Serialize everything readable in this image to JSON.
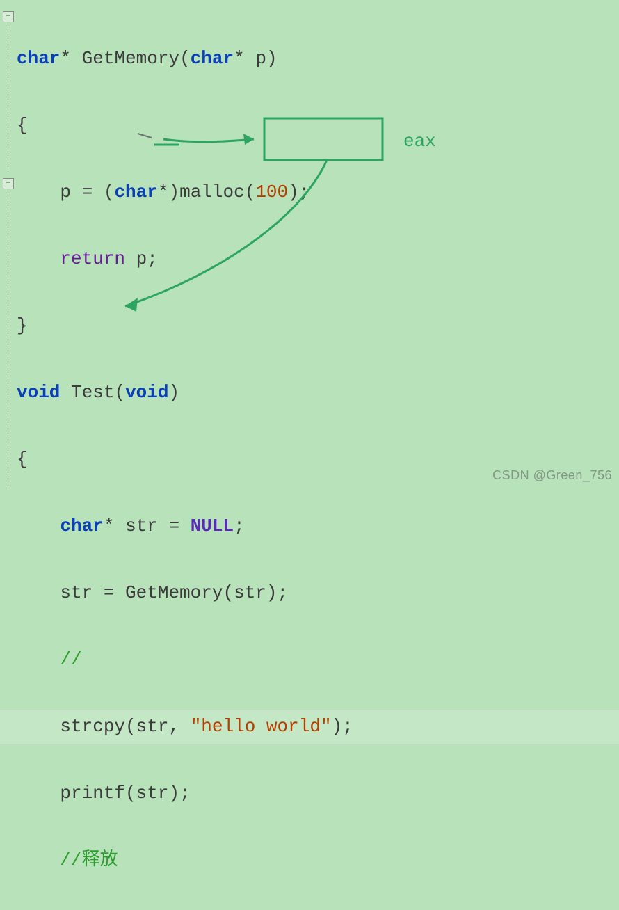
{
  "code": {
    "l1": {
      "kw1": "char",
      "star1": "*",
      "fn": "GetMemory",
      "lp": "(",
      "kw2": "char",
      "star2": "*",
      "p": "p",
      "rp": ")"
    },
    "l2": {
      "brace": "{"
    },
    "l3": {
      "p": "p",
      "eq": " = ",
      "lp": "(",
      "kw": "char",
      "star": "*",
      "rp": ")",
      "fn": "malloc",
      "lp2": "(",
      "num": "100",
      "rp2": ");"
    },
    "l4": {
      "ret": "return",
      "sp": " ",
      "p": "p",
      "semi": ";"
    },
    "l5": {
      "brace": "}"
    },
    "l6": {
      "kw1": "void",
      "fn": "Test",
      "lp": "(",
      "kw2": "void",
      "rp": ")"
    },
    "l7": {
      "brace": "{"
    },
    "l8": {
      "kw": "char",
      "star": "*",
      "id": "str",
      "eq": " = ",
      "null": "NULL",
      "semi": ";"
    },
    "l9": {
      "id": "str",
      "eq": " = ",
      "fn": "GetMemory",
      "lp": "(",
      "arg": "str",
      "rp": ");"
    },
    "l10": {
      "cmt": "//"
    },
    "l11": {
      "fn": "strcpy",
      "lp": "(",
      "a1": "str",
      "comma": ", ",
      "str": "\"hello world\"",
      "rp": ");"
    },
    "l12": {
      "fn": "printf",
      "lp": "(",
      "a1": "str",
      "rp": ");"
    },
    "l13": {
      "cmt": "//释放"
    }
  },
  "annotation": {
    "eax_label": "eax"
  },
  "watermark": "CSDN @Green_756"
}
